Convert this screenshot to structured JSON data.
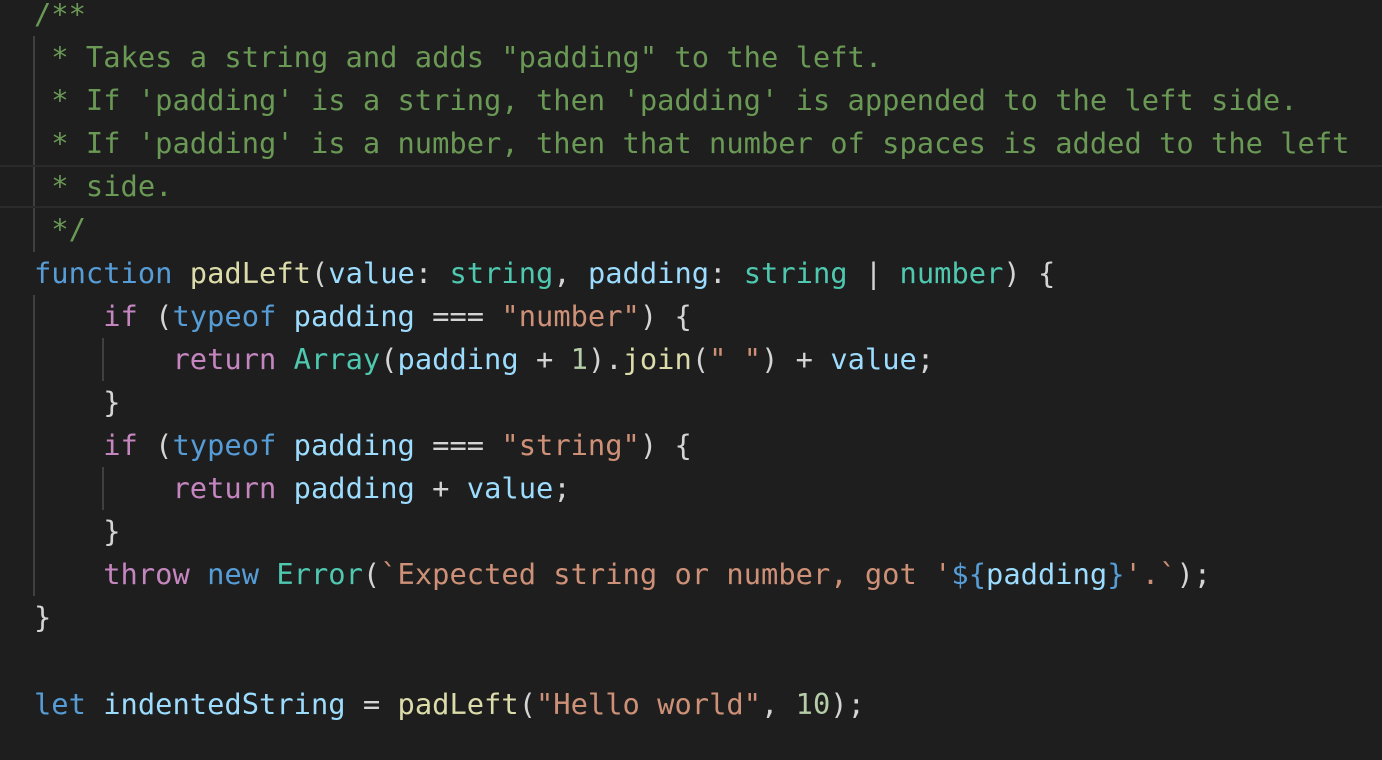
{
  "editor": {
    "colors": {
      "background": "#1e1e1e",
      "comment": "#6a9955",
      "keyword": "#569cd6",
      "control": "#c586c0",
      "variable": "#9cdcfe",
      "type": "#4ec9b0",
      "function": "#dcdcaa",
      "string": "#ce9178",
      "number": "#b5cea8",
      "text": "#d4d4d4"
    },
    "current_line": 4,
    "lines": [
      {
        "guides": [],
        "tokens": [
          [
            "/**",
            "c"
          ]
        ]
      },
      {
        "guides": [
          0
        ],
        "tokens": [
          [
            " * Takes a string and adds \"padding\" to the left.",
            "c"
          ]
        ]
      },
      {
        "guides": [
          0
        ],
        "tokens": [
          [
            " * If 'padding' is a string, then 'padding' is appended to the left side.",
            "c"
          ]
        ]
      },
      {
        "guides": [
          0
        ],
        "tokens": [
          [
            " * If 'padding' is a number, then that number of spaces is added to the left",
            "c"
          ]
        ]
      },
      {
        "guides": [
          0
        ],
        "tokens": [
          [
            " * side.",
            "c"
          ]
        ]
      },
      {
        "guides": [
          0
        ],
        "tokens": [
          [
            " */",
            "c"
          ]
        ]
      },
      {
        "guides": [],
        "tokens": [
          [
            "function",
            "k"
          ],
          [
            " ",
            "p"
          ],
          [
            "padLeft",
            "f"
          ],
          [
            "(",
            "p"
          ],
          [
            "value",
            "v"
          ],
          [
            ": ",
            "p"
          ],
          [
            "string",
            "t"
          ],
          [
            ", ",
            "p"
          ],
          [
            "padding",
            "v"
          ],
          [
            ": ",
            "p"
          ],
          [
            "string",
            "t"
          ],
          [
            " | ",
            "p"
          ],
          [
            "number",
            "t"
          ],
          [
            ") {",
            "p"
          ]
        ]
      },
      {
        "guides": [
          0
        ],
        "tokens": [
          [
            "    ",
            "p"
          ],
          [
            "if",
            "ctl"
          ],
          [
            " (",
            "p"
          ],
          [
            "typeof",
            "k"
          ],
          [
            " ",
            "p"
          ],
          [
            "padding",
            "v"
          ],
          [
            " === ",
            "p"
          ],
          [
            "\"number\"",
            "s"
          ],
          [
            ") {",
            "p"
          ]
        ]
      },
      {
        "guides": [
          0,
          4
        ],
        "tokens": [
          [
            "        ",
            "p"
          ],
          [
            "return",
            "ctl"
          ],
          [
            " ",
            "p"
          ],
          [
            "Array",
            "t"
          ],
          [
            "(",
            "p"
          ],
          [
            "padding",
            "v"
          ],
          [
            " + ",
            "p"
          ],
          [
            "1",
            "n"
          ],
          [
            ").",
            "p"
          ],
          [
            "join",
            "f"
          ],
          [
            "(",
            "p"
          ],
          [
            "\" \"",
            "s"
          ],
          [
            ") + ",
            "p"
          ],
          [
            "value",
            "v"
          ],
          [
            ";",
            "p"
          ]
        ]
      },
      {
        "guides": [
          0
        ],
        "tokens": [
          [
            "    }",
            "p"
          ]
        ]
      },
      {
        "guides": [
          0
        ],
        "tokens": [
          [
            "    ",
            "p"
          ],
          [
            "if",
            "ctl"
          ],
          [
            " (",
            "p"
          ],
          [
            "typeof",
            "k"
          ],
          [
            " ",
            "p"
          ],
          [
            "padding",
            "v"
          ],
          [
            " === ",
            "p"
          ],
          [
            "\"string\"",
            "s"
          ],
          [
            ") {",
            "p"
          ]
        ]
      },
      {
        "guides": [
          0,
          4
        ],
        "tokens": [
          [
            "        ",
            "p"
          ],
          [
            "return",
            "ctl"
          ],
          [
            " ",
            "p"
          ],
          [
            "padding",
            "v"
          ],
          [
            " + ",
            "p"
          ],
          [
            "value",
            "v"
          ],
          [
            ";",
            "p"
          ]
        ]
      },
      {
        "guides": [
          0
        ],
        "tokens": [
          [
            "    }",
            "p"
          ]
        ]
      },
      {
        "guides": [
          0
        ],
        "tokens": [
          [
            "    ",
            "p"
          ],
          [
            "throw",
            "ctl"
          ],
          [
            " ",
            "p"
          ],
          [
            "new",
            "k"
          ],
          [
            " ",
            "p"
          ],
          [
            "Error",
            "t"
          ],
          [
            "(",
            "p"
          ],
          [
            "`Expected string or number, got '",
            "s"
          ],
          [
            "${",
            "k"
          ],
          [
            "padding",
            "v"
          ],
          [
            "}",
            "k"
          ],
          [
            "'.`",
            "s"
          ],
          [
            ");",
            "p"
          ]
        ]
      },
      {
        "guides": [],
        "tokens": [
          [
            "}",
            "p"
          ]
        ]
      },
      {
        "guides": [],
        "tokens": []
      },
      {
        "guides": [],
        "tokens": [
          [
            "let",
            "k"
          ],
          [
            " ",
            "p"
          ],
          [
            "indentedString",
            "v"
          ],
          [
            " = ",
            "p"
          ],
          [
            "padLeft",
            "f"
          ],
          [
            "(",
            "p"
          ],
          [
            "\"Hello world\"",
            "s"
          ],
          [
            ", ",
            "p"
          ],
          [
            "10",
            "n"
          ],
          [
            ");",
            "p"
          ]
        ]
      }
    ]
  }
}
